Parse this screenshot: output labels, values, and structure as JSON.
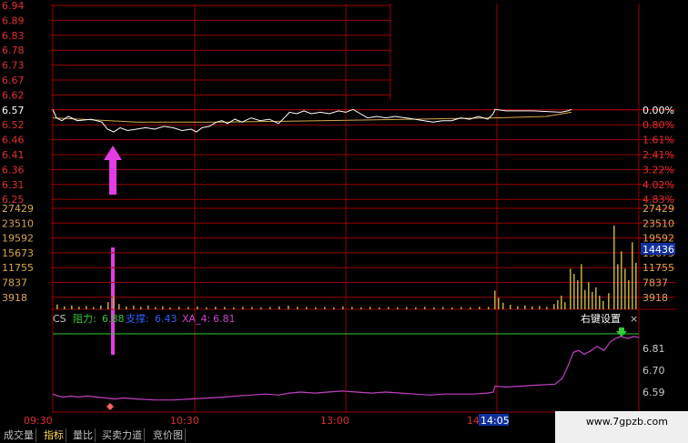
{
  "price_panel": {
    "left_ticks": [
      "6.94",
      "6.89",
      "6.83",
      "6.78",
      "6.73",
      "6.67",
      "6.62",
      "6.57",
      "6.52",
      "6.46",
      "6.41",
      "6.36",
      "6.31",
      "6.25"
    ],
    "left_ticks_highlight_index": 7,
    "right_ticks": [
      "0.00%",
      "0.80%",
      "1.61%",
      "2.41%",
      "3.22%",
      "4.02%",
      "4.83%"
    ],
    "right_ticks_highlight_index": 0,
    "colors": {
      "grid": "#990000",
      "line": "#ffffff",
      "avg": "#d9a64e",
      "left_text": "#e03030",
      "right_text": "#e03030",
      "arrow": "#e33ce3"
    }
  },
  "volume_panel": {
    "left_ticks": [
      "27429",
      "23510",
      "19592",
      "15673",
      "11755",
      "7837",
      "3918"
    ],
    "right_ticks": [
      "27429",
      "23510",
      "19592",
      "15673",
      "11755",
      "7837",
      "3918"
    ],
    "current_value": "14436",
    "colors": {
      "bar": "#b9a33a",
      "text": "#d9a64e",
      "badge_bg": "#1030a0",
      "badge_text": "#ffffff"
    }
  },
  "indicator_panel": {
    "name": "CS",
    "resistance_label": "阻力:",
    "resistance_value": "6.88",
    "support_label": "支撑:",
    "support_value": "6.43",
    "xa_label": "XA_4:",
    "xa_value": "6.81",
    "settings_label": "右键设置",
    "close_glyph": "×",
    "right_ticks": [
      "6.81",
      "6.70",
      "6.59"
    ],
    "colors": {
      "resist": "#33cc33",
      "support": "#3060ff",
      "xa": "#d040d0",
      "line": "#c040c0",
      "diamond": "#ff6060"
    }
  },
  "time_axis": {
    "labels": [
      "09:30",
      "10:30",
      "13:00",
      "14"
    ],
    "cursor_time": "14:05",
    "colors": {
      "text": "#e03030",
      "cursor_bg": "#1030a0",
      "cursor_text": "#ffffff"
    }
  },
  "tabs": [
    {
      "label": "成交量",
      "active": false
    },
    {
      "label": "指标",
      "active": true
    },
    {
      "label": "量比",
      "active": false
    },
    {
      "label": "买卖力道",
      "active": false
    },
    {
      "label": "竞价图",
      "active": false
    }
  ],
  "watermark": "www.7gpzb.com"
}
